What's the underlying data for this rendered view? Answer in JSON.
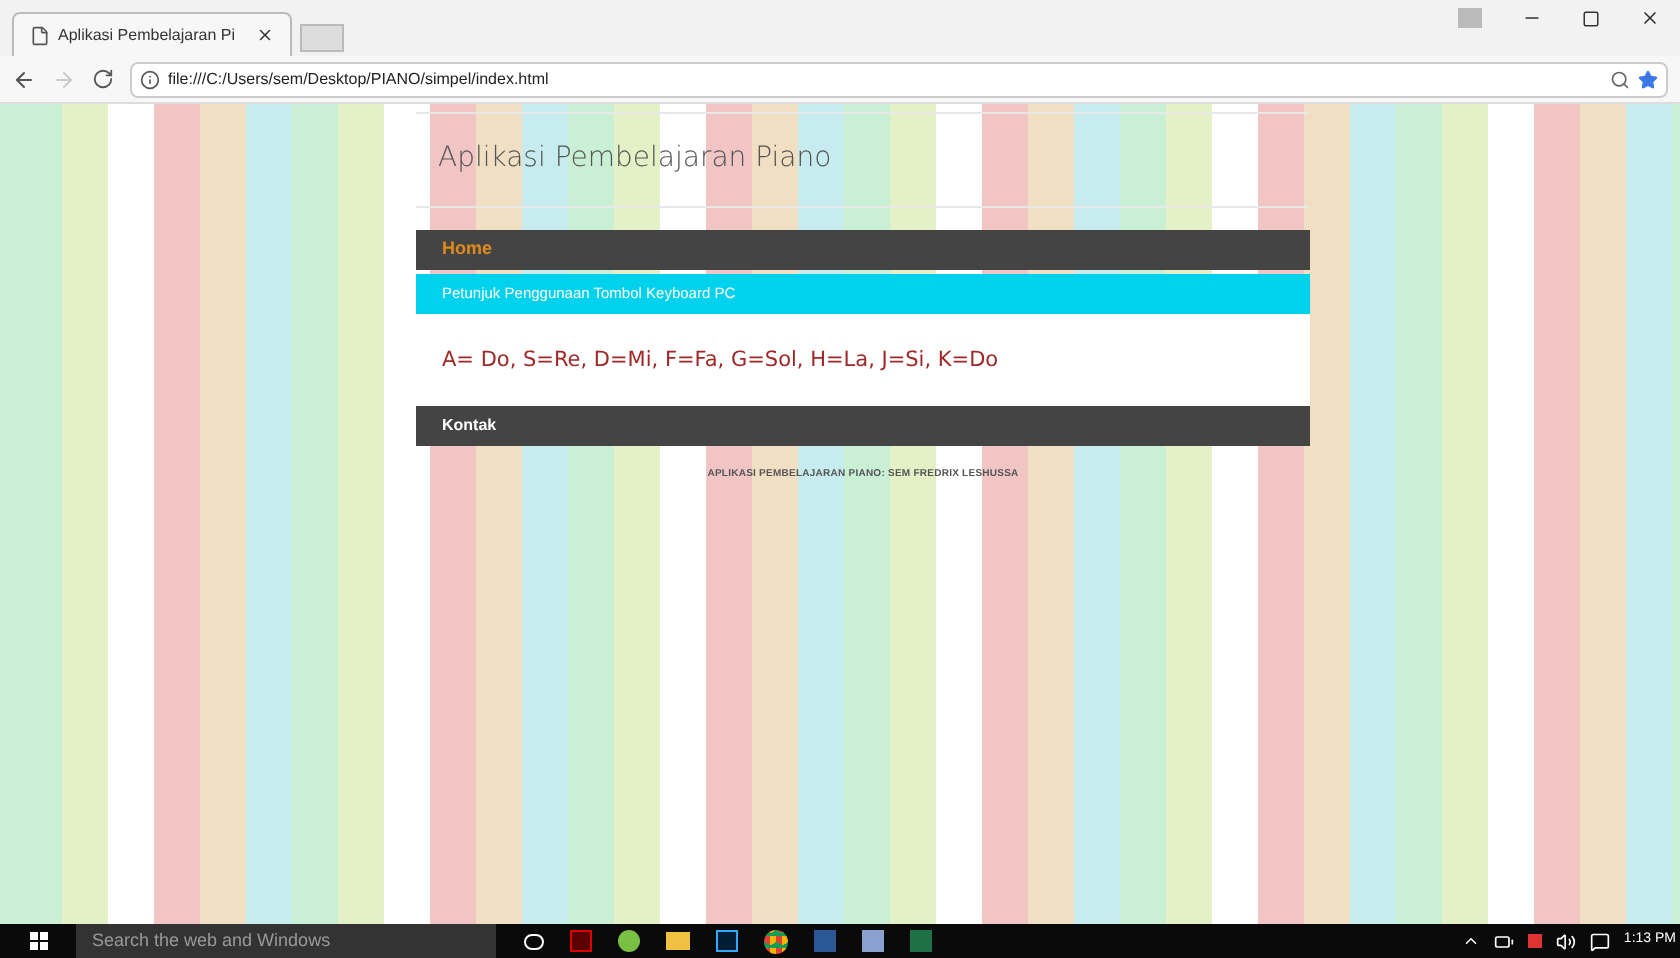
{
  "browser": {
    "tab_title": "Aplikasi Pembelajaran Pi",
    "url": "file:///C:/Users/sem/Desktop/PIANO/simpel/index.html"
  },
  "page": {
    "title": "Aplikasi Pembelajaran Piano",
    "nav": [
      {
        "label": "Home",
        "selected": true
      }
    ],
    "section_heading": "Petunjuk Penggunaan Tombol Keyboard PC",
    "key_map": "A= Do, S=Re, D=Mi, F=Fa, G=Sol, H=La, J=Si, K=Do",
    "contact_bar": "Kontak",
    "footer": "APLIKASI PEMBELAJARAN PIANO: SEM FREDRIX LESHUSSA"
  },
  "taskbar": {
    "search_placeholder": "Search the web and Windows",
    "clock": "1:13 PM"
  }
}
